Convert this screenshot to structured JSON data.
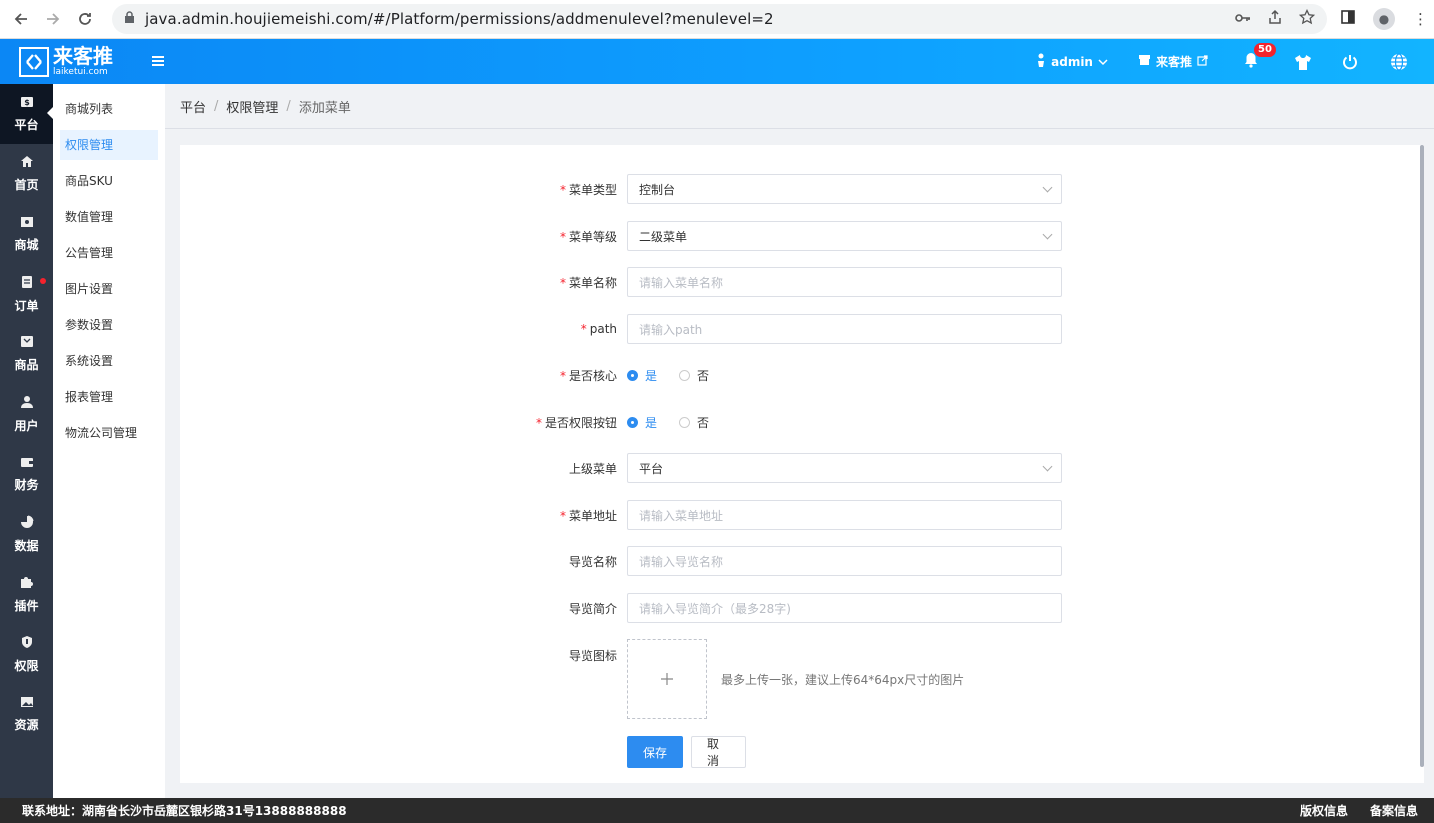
{
  "browser": {
    "url": "java.admin.houjiemeishi.com/#/Platform/permissions/addmenulevel?menulevel=2"
  },
  "header": {
    "logo_cn": "来客推",
    "logo_en": "laiketui.com",
    "user": "admin",
    "store": "来客推",
    "notification_count": "50"
  },
  "icon_sidebar": [
    {
      "label": "平台",
      "icon": "platform-icon"
    },
    {
      "label": "首页",
      "icon": "home-icon"
    },
    {
      "label": "商城",
      "icon": "mall-icon"
    },
    {
      "label": "订单",
      "icon": "order-icon"
    },
    {
      "label": "商品",
      "icon": "goods-icon"
    },
    {
      "label": "用户",
      "icon": "user-icon"
    },
    {
      "label": "财务",
      "icon": "wallet-icon"
    },
    {
      "label": "数据",
      "icon": "pie-chart-icon"
    },
    {
      "label": "插件",
      "icon": "puzzle-icon"
    },
    {
      "label": "权限",
      "icon": "shield-icon"
    },
    {
      "label": "资源",
      "icon": "image-icon"
    }
  ],
  "sub_sidebar": [
    {
      "label": "商城列表"
    },
    {
      "label": "权限管理"
    },
    {
      "label": "商品SKU"
    },
    {
      "label": "数值管理"
    },
    {
      "label": "公告管理"
    },
    {
      "label": "图片设置"
    },
    {
      "label": "参数设置"
    },
    {
      "label": "系统设置"
    },
    {
      "label": "报表管理"
    },
    {
      "label": "物流公司管理"
    }
  ],
  "breadcrumb": {
    "level1": "平台",
    "level2": "权限管理",
    "level3": "添加菜单",
    "sep": "/"
  },
  "form": {
    "menu_type": {
      "label": "菜单类型",
      "value": "控制台"
    },
    "menu_level": {
      "label": "菜单等级",
      "value": "二级菜单"
    },
    "menu_name": {
      "label": "菜单名称",
      "placeholder": "请输入菜单名称"
    },
    "path": {
      "label": "path",
      "placeholder": "请输入path"
    },
    "is_core": {
      "label": "是否核心",
      "yes": "是",
      "no": "否"
    },
    "is_permission_button": {
      "label": "是否权限按钮",
      "yes": "是",
      "no": "否"
    },
    "parent_menu": {
      "label": "上级菜单",
      "value": "平台"
    },
    "menu_address": {
      "label": "菜单地址",
      "placeholder": "请输入菜单地址"
    },
    "guide_name": {
      "label": "导览名称",
      "placeholder": "请输入导览名称"
    },
    "guide_intro": {
      "label": "导览简介",
      "placeholder": "请输入导览简介（最多28字)"
    },
    "guide_icon": {
      "label": "导览图标",
      "hint": "最多上传一张，建议上传64*64px尺寸的图片"
    },
    "save": "保存",
    "cancel": "取消"
  },
  "footer": {
    "address": "联系地址：湖南省长沙市岳麓区银杉路31号13888888888",
    "copyright": "版权信息",
    "icp": "备案信息"
  }
}
